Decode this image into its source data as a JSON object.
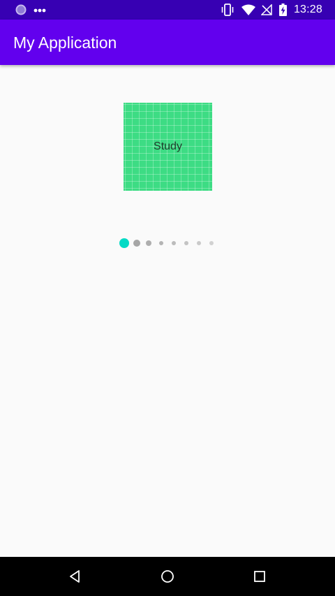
{
  "status_bar": {
    "time": "13:28",
    "icons": [
      "app-notification-icon",
      "more-notifications-icon",
      "vibrate-icon",
      "wifi-icon",
      "no-signal-icon",
      "battery-charging-icon"
    ]
  },
  "app_bar": {
    "title": "My Application"
  },
  "pager": {
    "current_page_label": "Study",
    "page_count": 8,
    "current_index": 0,
    "colors": {
      "card": "#3ddc84",
      "active_dot": "#03dac5",
      "inactive_dot": "#9e9e9e"
    }
  },
  "nav_bar": {
    "buttons": [
      "back-icon",
      "home-icon",
      "recents-icon"
    ]
  }
}
